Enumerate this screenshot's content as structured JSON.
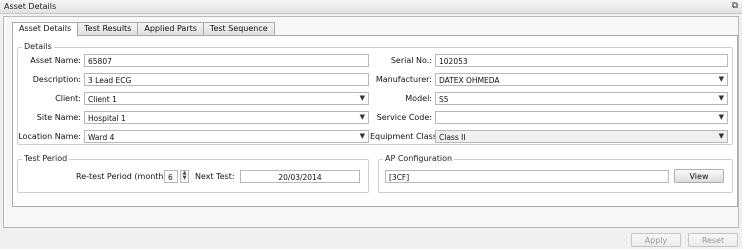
{
  "window": {
    "title": "Asset Details",
    "pin_icon": "pin-icon"
  },
  "tabs": [
    {
      "label": "Asset Details",
      "active": true
    },
    {
      "label": "Test Results",
      "active": false
    },
    {
      "label": "Applied Parts",
      "active": false
    },
    {
      "label": "Test Sequence",
      "active": false
    }
  ],
  "details": {
    "group_title": "Details",
    "asset_name": {
      "label": "Asset Name:",
      "value": "65807"
    },
    "description": {
      "label": "Description:",
      "value": "3 Lead ECG"
    },
    "client": {
      "label": "Client:",
      "value": "Client 1"
    },
    "site_name": {
      "label": "Site Name:",
      "value": "Hospital 1"
    },
    "location_name": {
      "label": "Location Name:",
      "value": "Ward 4"
    },
    "serial_no": {
      "label": "Serial No.:",
      "value": "102053"
    },
    "manufacturer": {
      "label": "Manufacturer:",
      "value": "DATEX OHMEDA"
    },
    "model": {
      "label": "Model:",
      "value": "S5"
    },
    "service_code": {
      "label": "Service Code:",
      "value": ""
    },
    "equipment_class": {
      "label": "Equipment Class:",
      "value": "Class II"
    }
  },
  "test_period": {
    "group_title": "Test Period",
    "retest_label": "Re-test Period (months):",
    "retest_value": "6",
    "next_test_label": "Next Test:",
    "next_test_value": "20/03/2014"
  },
  "ap_config": {
    "group_title": "AP Configuration",
    "value": "[3CF]",
    "view_label": "View"
  },
  "footer": {
    "apply_label": "Apply",
    "reset_label": "Reset"
  }
}
